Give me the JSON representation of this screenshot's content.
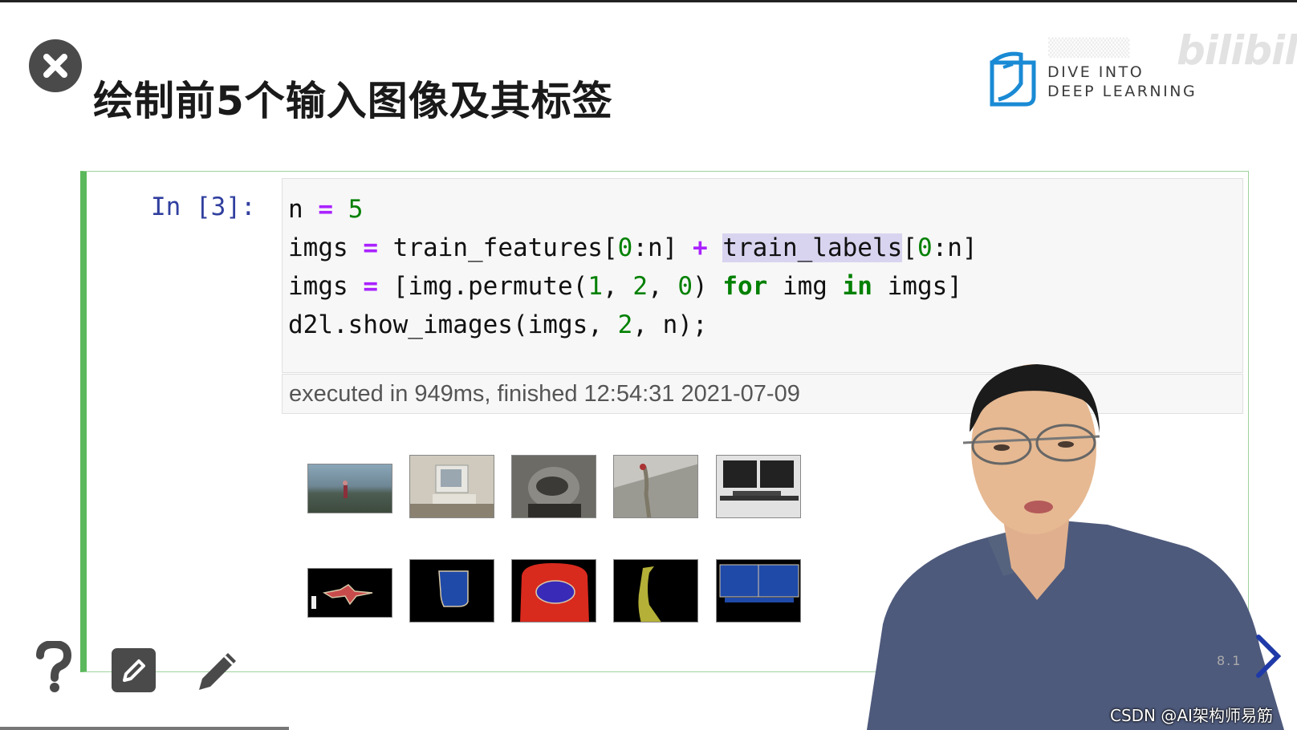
{
  "slide": {
    "title": "绘制前5个输入图像及其标签",
    "slide_number": "8.1"
  },
  "logo": {
    "line1": "DIVE INTO",
    "line2": "DEEP LEARNING",
    "accent_color": "#1a8ad4"
  },
  "watermark": {
    "site": "bilibili"
  },
  "cell": {
    "prompt": "In [3]:",
    "code": {
      "line1": {
        "var": "n",
        "op": "=",
        "num": "5"
      },
      "line2": {
        "var": "imgs",
        "op": "=",
        "a": "train_features",
        "slice_open": "[",
        "s0": "0",
        "slice_rest": ":n]",
        "plus": "+",
        "b": "train_labels",
        "slice_open2": "[",
        "s1": "0",
        "slice_rest2": ":n]"
      },
      "line3": {
        "var": "imgs",
        "op": "=",
        "pre": "[img.permute(",
        "n1": "1",
        "c1": ", ",
        "n2": "2",
        "c2": ", ",
        "n3": "0",
        "post": ") ",
        "kw_for": "for",
        "mid": " img ",
        "kw_in": "in",
        "tail": " imgs]"
      },
      "line4": {
        "pre": "d2l.show_images(imgs, ",
        "n": "2",
        "tail": ", n);"
      }
    },
    "execution_info": "executed in 949ms, finished 12:54:31 2021-07-09",
    "accent_color": "#5cb85c"
  },
  "output_images": {
    "features": [
      "field-photo",
      "computer-desk-photo",
      "cat-on-chair-photo",
      "bird-photo",
      "monitors-photo"
    ],
    "labels": [
      "person-mask",
      "monitor-mask",
      "cat-chair-mask",
      "bird-mask",
      "monitors-mask"
    ]
  },
  "footer": {
    "credit": "CSDN @AI架构师易筋"
  }
}
